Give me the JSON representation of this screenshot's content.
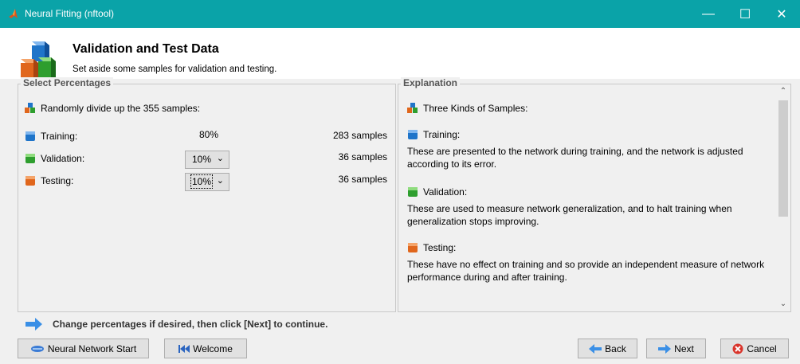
{
  "window": {
    "title": "Neural Fitting (nftool)",
    "minimize_glyph": "—",
    "maximize_glyph": "☐",
    "close_glyph": "✕"
  },
  "header": {
    "title": "Validation and Test Data",
    "subtitle": "Set aside some samples for validation and testing."
  },
  "select_panel": {
    "label": "Select Percentages",
    "intro": "Randomly divide up the 355 samples:",
    "rows": [
      {
        "label": "Training:",
        "percent": "80%",
        "samples": "283 samples",
        "icon": "blue-cube-icon"
      },
      {
        "label": "Validation:",
        "percent": "10%",
        "samples": "36 samples",
        "icon": "green-cube-icon"
      },
      {
        "label": "Testing:",
        "percent": "10%",
        "samples": "36 samples",
        "icon": "orange-cube-icon"
      }
    ]
  },
  "explanation_panel": {
    "label": "Explanation",
    "heading": "Three Kinds of Samples:",
    "training_title": "Training:",
    "training_text": "These are presented to the network during training, and the network is adjusted according to its error.",
    "validation_title": "Validation:",
    "validation_text": "These are used to measure network generalization, and to halt training when generalization stops improving.",
    "testing_title": "Testing:",
    "testing_text": "These have no effect on training and so provide an independent measure of network performance during and after training."
  },
  "instruction": "Change percentages if desired, then click [Next] to continue.",
  "buttons": {
    "nn_start": "Neural Network Start",
    "welcome": "Welcome",
    "back": "Back",
    "next": "Next",
    "cancel": "Cancel"
  },
  "colors": {
    "titlebar": "#0aa3a8",
    "cube_blue": "#1f74c9",
    "cube_green": "#2e9e2e",
    "cube_orange": "#e0661c"
  }
}
